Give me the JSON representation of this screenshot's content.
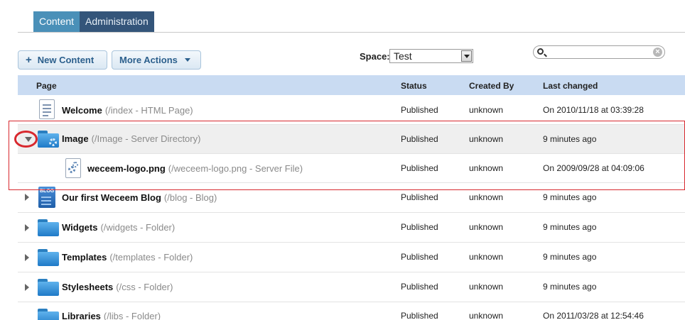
{
  "tabs": [
    {
      "label": "Content",
      "active": true
    },
    {
      "label": "Administration",
      "active": false
    }
  ],
  "toolbar": {
    "new_content_label": "New Content",
    "more_actions_label": "More Actions",
    "space_label": "Space:",
    "space_value": "Test",
    "search_value": "",
    "search_placeholder": ""
  },
  "table": {
    "columns": {
      "page": "Page",
      "status": "Status",
      "created_by": "Created By",
      "last_changed": "Last changed"
    },
    "rows": [
      {
        "icon": "html-page-icon",
        "title": "Welcome",
        "meta": "(/index - HTML Page)",
        "status": "Published",
        "created_by": "unknown",
        "last_changed": "On 2010/11/18 at 03:39:28",
        "toggle": "none",
        "indent": 0,
        "selected": false
      },
      {
        "icon": "server-directory-icon",
        "title": "Image",
        "meta": "(/Image - Server Directory)",
        "status": "Published",
        "created_by": "unknown",
        "last_changed": "9 minutes ago",
        "toggle": "open",
        "indent": 0,
        "selected": true
      },
      {
        "icon": "server-file-icon",
        "title": "weceem-logo.png",
        "meta": "(/weceem-logo.png - Server File)",
        "status": "Published",
        "created_by": "unknown",
        "last_changed": "On 2009/09/28 at 04:09:06",
        "toggle": "none",
        "indent": 1,
        "selected": false
      },
      {
        "icon": "blog-icon",
        "title": "Our first Weceem Blog",
        "meta": "(/blog - Blog)",
        "status": "Published",
        "created_by": "unknown",
        "last_changed": "9 minutes ago",
        "toggle": "closed",
        "indent": 0,
        "selected": false
      },
      {
        "icon": "folder-icon",
        "title": "Widgets",
        "meta": "(/widgets - Folder)",
        "status": "Published",
        "created_by": "unknown",
        "last_changed": "9 minutes ago",
        "toggle": "closed",
        "indent": 0,
        "selected": false
      },
      {
        "icon": "folder-icon",
        "title": "Templates",
        "meta": "(/templates - Folder)",
        "status": "Published",
        "created_by": "unknown",
        "last_changed": "9 minutes ago",
        "toggle": "closed",
        "indent": 0,
        "selected": false
      },
      {
        "icon": "folder-icon",
        "title": "Stylesheets",
        "meta": "(/css - Folder)",
        "status": "Published",
        "created_by": "unknown",
        "last_changed": "9 minutes ago",
        "toggle": "closed",
        "indent": 0,
        "selected": false
      },
      {
        "icon": "folder-icon",
        "title": "Libraries",
        "meta": "(/libs - Folder)",
        "status": "Published",
        "created_by": "unknown",
        "last_changed": "On 2011/03/28 at 12:54:46",
        "toggle": "none",
        "indent": 0,
        "selected": false
      }
    ]
  },
  "colors": {
    "tab_active": "#4a90b8",
    "tab_inactive": "#34557a",
    "header_bg": "#c9dbf2",
    "annotation": "#d8282e"
  }
}
